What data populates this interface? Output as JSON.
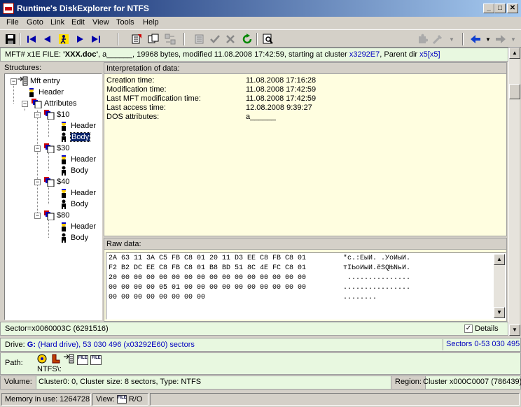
{
  "window": {
    "title": "Runtime's DiskExplorer for NTFS"
  },
  "menu": [
    "File",
    "Goto",
    "Link",
    "Edit",
    "View",
    "Tools",
    "Help"
  ],
  "info": {
    "mft_label": "MFT# x1E",
    "file_label": "FILE:",
    "filename": "'XXX.doc'",
    "attrs": "a______",
    "details": "19968 bytes, modified 11.08.2008 17:42:59, starting at cluster",
    "cluster_link": "x3292E7",
    "parent_label": "Parent dir",
    "parent_link": "x5[x5]"
  },
  "structures": {
    "label": "Structures:",
    "tree": [
      {
        "label": "Mft entry"
      },
      {
        "label": "Header"
      },
      {
        "label": "Attributes"
      },
      {
        "label": "$10"
      },
      {
        "label": "Header"
      },
      {
        "label": "Body"
      },
      {
        "label": "$30"
      },
      {
        "label": "Header"
      },
      {
        "label": "Body"
      },
      {
        "label": "$40"
      },
      {
        "label": "Header"
      },
      {
        "label": "Body"
      },
      {
        "label": "$80"
      },
      {
        "label": "Header"
      },
      {
        "label": "Body"
      }
    ]
  },
  "interpretation": {
    "header": "Interpretation of data:",
    "rows": [
      {
        "label": "Creation time:",
        "value": "11.08.2008 17:16:28"
      },
      {
        "label": "Modification time:",
        "value": "11.08.2008 17:42:59"
      },
      {
        "label": "Last MFT modification time:",
        "value": "11.08.2008 17:42:59"
      },
      {
        "label": "Last access time:",
        "value": "12.08.2008 9:39:27"
      },
      {
        "label": "DOS attributes:",
        "value": "a______"
      }
    ]
  },
  "raw": {
    "header": "Raw data:",
    "hex": [
      "2A 63 11 3A C5 FB C8 01 20 11 D3 EE C8 FB C8 01",
      "F2 B2 DC EE C8 FB C8 01 B8 BD 51 8C 4E FC C8 01",
      "20 00 00 00 00 00 00 00 00 00 00 00 00 00 00 00",
      "00 00 00 00 05 01 00 00 00 00 00 00 00 00 00 00",
      "00 00 00 00 00 00 00 00"
    ],
    "ascii": [
      "*c.:ЕыИ. .УоИыИ.",
      "тІЬоИыИ.ёЅQЊNьИ.",
      " ...............",
      "................",
      "........"
    ]
  },
  "sector": {
    "text": "Sector=x0060003C (6291516)",
    "details_label": "Details",
    "details_checked": true
  },
  "drive": {
    "label": "Drive:",
    "letter": "G:",
    "info": "(Hard drive), 53 030 496 (x03292E60) sectors",
    "sectors": "Sectors 0-53 030 495"
  },
  "path": {
    "label": "Path:",
    "text": "NTFS\\:",
    "icon_text": "FILE"
  },
  "volume": {
    "label": "Volume:",
    "info": "Cluster0: 0, Cluster size: 8 sectors, Type: NTFS",
    "region_label": "Region:",
    "region": "Cluster x000C0007 (786439)"
  },
  "status": {
    "memory": "Memory in use: 1264728",
    "view_label": "View:",
    "view_mode": "R/O",
    "icon_text": "FILE"
  }
}
